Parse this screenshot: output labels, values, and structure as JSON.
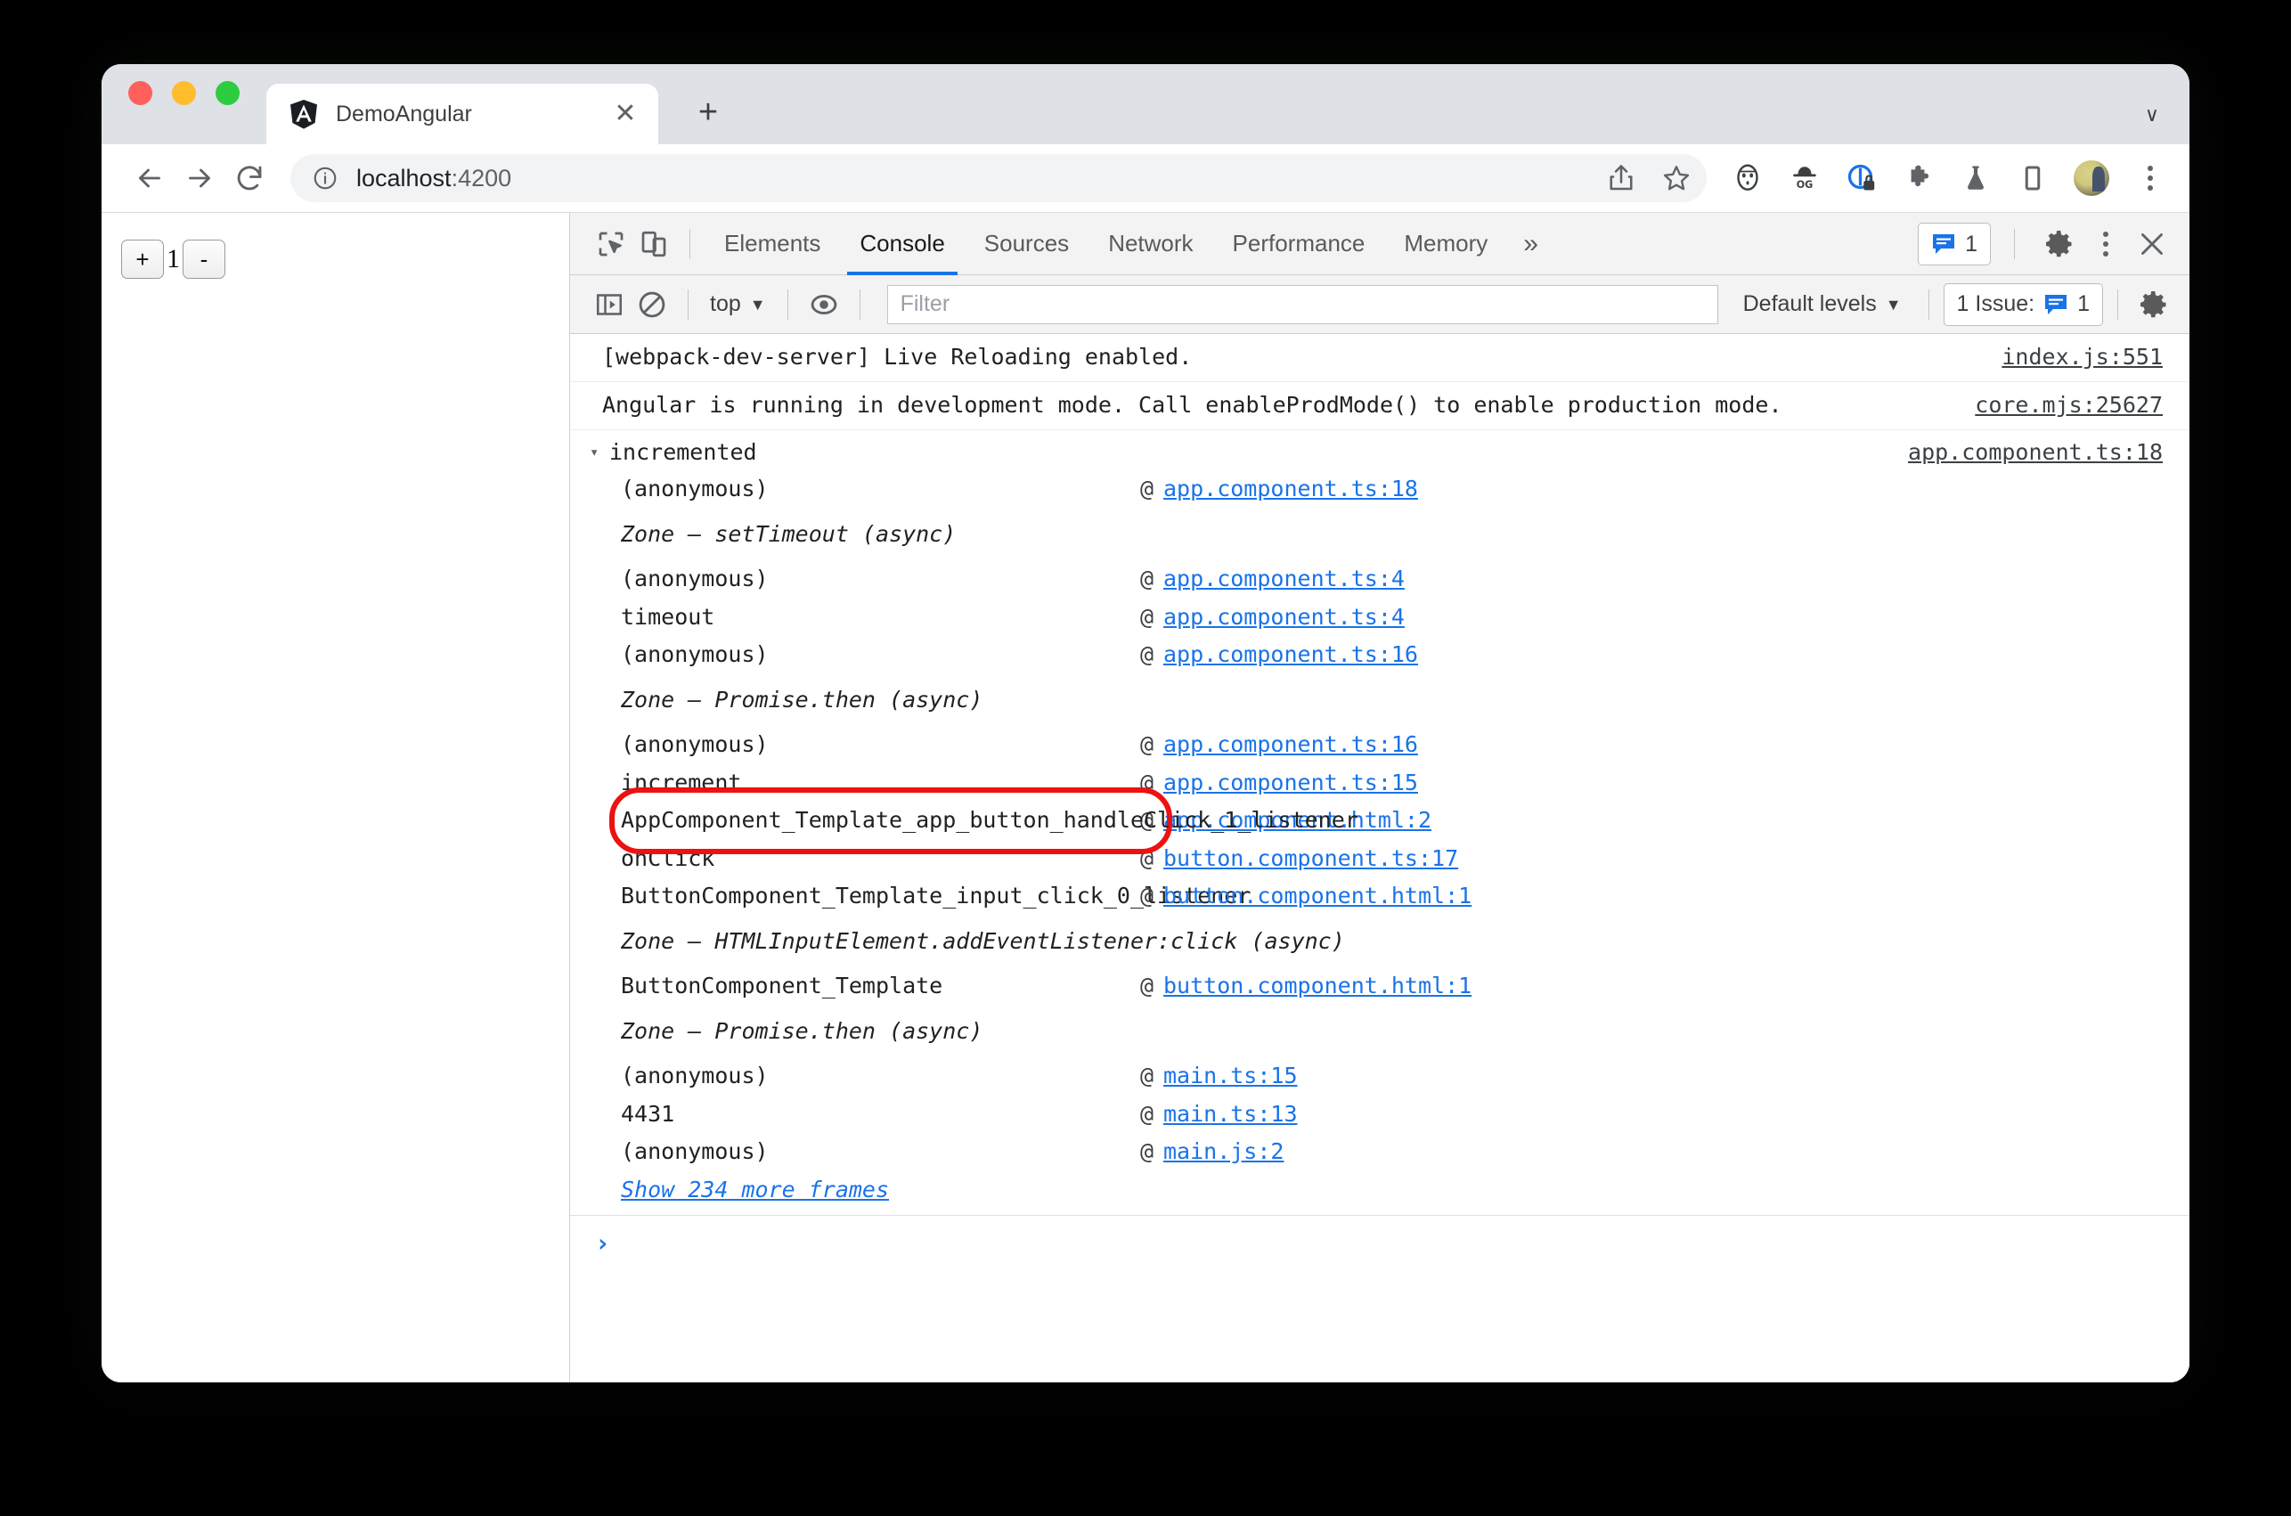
{
  "browser": {
    "traffic_lights": [
      "close",
      "minimize",
      "maximize"
    ],
    "tab": {
      "title": "DemoAngular",
      "favicon": "angular-logo-icon",
      "close": "✕"
    },
    "new_tab_label": "+",
    "tabstrip_menu": "∨",
    "omnibox": {
      "url_host": "localhost",
      "url_port": ":4200",
      "info_icon": "site-info-icon",
      "share_icon": "share-icon",
      "bookmark_icon": "star-icon"
    },
    "extensions": [
      "mask-icon",
      "og-hat-icon",
      "privacy-lock-icon",
      "puzzle-extension-icon",
      "flask-icon",
      "reading-list-icon"
    ],
    "avatar": "profile-avatar",
    "menu": "chrome-menu-icon"
  },
  "page": {
    "increment_label": "+",
    "counter_value": "1",
    "decrement_label": "-"
  },
  "devtools": {
    "inspect_icon": "inspect-element-icon",
    "device_icon": "device-toolbar-icon",
    "tabs": [
      {
        "label": "Elements",
        "active": false
      },
      {
        "label": "Console",
        "active": true
      },
      {
        "label": "Sources",
        "active": false
      },
      {
        "label": "Network",
        "active": false
      },
      {
        "label": "Performance",
        "active": false
      },
      {
        "label": "Memory",
        "active": false
      }
    ],
    "more_tabs": "»",
    "message_count": "1",
    "settings_icon": "gear-icon",
    "kebab_icon": "more-options-icon",
    "close_icon": "close-icon",
    "filterbar": {
      "sidebar_icon": "console-sidebar-icon",
      "clear_icon": "clear-console-icon",
      "context": "top",
      "eye_icon": "live-expression-icon",
      "filter_placeholder": "Filter",
      "levels": "Default levels",
      "issues_label": "1 Issue:",
      "issues_count": "1",
      "settings_icon": "gear-icon"
    },
    "messages": [
      {
        "text": "[webpack-dev-server] Live Reloading enabled.",
        "link": "index.js:551"
      },
      {
        "text": "Angular is running in development mode. Call enableProdMode() to enable production mode.",
        "link": "core.mjs:25627"
      }
    ],
    "group": {
      "disclosure": "▾",
      "title": "incremented",
      "link": "app.component.ts:18"
    },
    "frames": [
      {
        "name": "(anonymous)",
        "at": "@",
        "link": "app.component.ts:18",
        "async": false,
        "highlight": false
      },
      {
        "name": "Zone — setTimeout (async)",
        "at": "",
        "link": "",
        "async": true,
        "highlight": false
      },
      {
        "name": "(anonymous)",
        "at": "@",
        "link": "app.component.ts:4",
        "async": false,
        "highlight": false
      },
      {
        "name": "timeout",
        "at": "@",
        "link": "app.component.ts:4",
        "async": false,
        "highlight": false
      },
      {
        "name": "(anonymous)",
        "at": "@",
        "link": "app.component.ts:16",
        "async": false,
        "highlight": false
      },
      {
        "name": "Zone — Promise.then (async)",
        "at": "",
        "link": "",
        "async": true,
        "highlight": false
      },
      {
        "name": "(anonymous)",
        "at": "@",
        "link": "app.component.ts:16",
        "async": false,
        "highlight": false
      },
      {
        "name": "increment",
        "at": "@",
        "link": "app.component.ts:15",
        "async": false,
        "highlight": false
      },
      {
        "name": "AppComponent_Template_app_button_handleClick_1_listener",
        "at": "@",
        "link": "app.component.html:2",
        "async": false,
        "highlight": true
      },
      {
        "name": "onClick",
        "at": "@",
        "link": "button.component.ts:17",
        "async": false,
        "highlight": false
      },
      {
        "name": "ButtonComponent_Template_input_click_0_listener",
        "at": "@",
        "link": "button.component.html:1",
        "async": false,
        "highlight": false
      },
      {
        "name": "Zone — HTMLInputElement.addEventListener:click (async)",
        "at": "",
        "link": "",
        "async": true,
        "highlight": false
      },
      {
        "name": "ButtonComponent_Template",
        "at": "@",
        "link": "button.component.html:1",
        "async": false,
        "highlight": false
      },
      {
        "name": "Zone — Promise.then (async)",
        "at": "",
        "link": "",
        "async": true,
        "highlight": false
      },
      {
        "name": "(anonymous)",
        "at": "@",
        "link": "main.ts:15",
        "async": false,
        "highlight": false
      },
      {
        "name": "4431",
        "at": "@",
        "link": "main.ts:13",
        "async": false,
        "highlight": false
      },
      {
        "name": "(anonymous)",
        "at": "@",
        "link": "main.js:2",
        "async": false,
        "highlight": false
      }
    ],
    "show_more_frames": "Show 234 more frames",
    "prompt": "›"
  },
  "colors": {
    "accent": "#1a73e8",
    "highlight_box": "#ee1111",
    "tabstrip_bg": "#dee1e6",
    "devtools_bg": "#f3f3f3"
  }
}
